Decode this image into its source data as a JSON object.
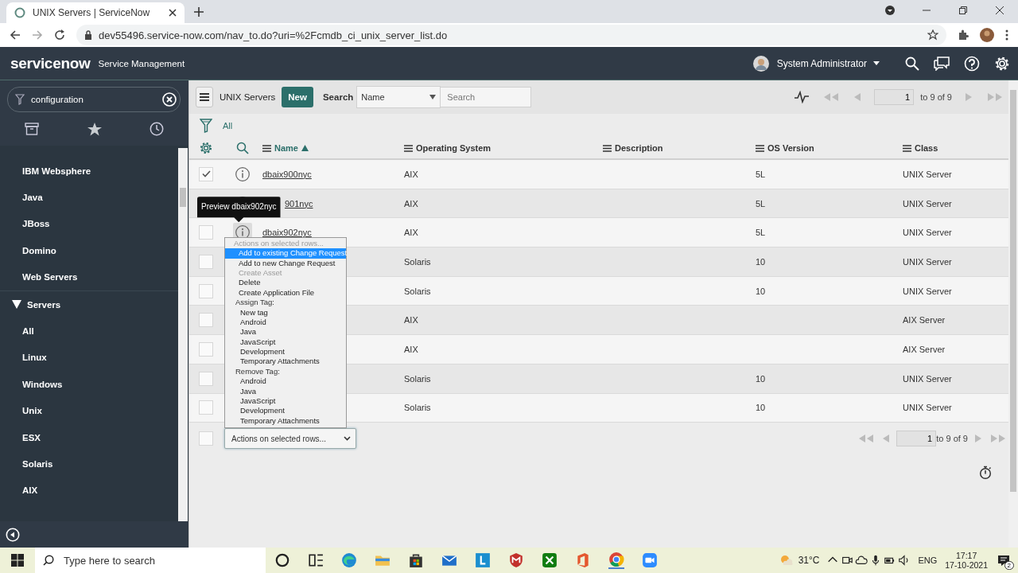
{
  "browser": {
    "tab": {
      "title": "UNIX Servers | ServiceNow",
      "selected": true
    },
    "address": "dev55496.service-now.com/nav_to.do?uri=%2Fcmdb_ci_unix_server_list.do"
  },
  "header": {
    "logo": "servicenow",
    "product": "Service Management",
    "user": "System Administrator"
  },
  "sidebar": {
    "filter": {
      "value": "configuration"
    },
    "items": [
      {
        "label": "IBM Websphere",
        "kind": "item"
      },
      {
        "label": "Java",
        "kind": "item"
      },
      {
        "label": "JBoss",
        "kind": "item"
      },
      {
        "label": "Domino",
        "kind": "item"
      },
      {
        "label": "Web Servers",
        "kind": "item"
      },
      {
        "label": "Servers",
        "kind": "section",
        "expanded": true,
        "children": [
          {
            "label": "All",
            "kind": "item"
          },
          {
            "label": "Linux",
            "kind": "item"
          },
          {
            "label": "Windows",
            "kind": "item"
          },
          {
            "label": "Unix",
            "kind": "item"
          },
          {
            "label": "ESX",
            "kind": "item"
          },
          {
            "label": "Solaris",
            "kind": "item"
          },
          {
            "label": "AIX",
            "kind": "item"
          }
        ]
      }
    ]
  },
  "list": {
    "title": "UNIX Servers",
    "new_button": "New",
    "search_label": "Search",
    "search_field": "Name",
    "search": {
      "placeholder": "Search"
    },
    "page": "1",
    "range": "to 9 of 9",
    "filter": "All",
    "columns": [
      {
        "label": "Name",
        "sorted": true
      },
      {
        "label": "Operating System",
        "sorted": false
      },
      {
        "label": "Description",
        "sorted": false
      },
      {
        "label": "OS Version",
        "sorted": false
      },
      {
        "label": "Class",
        "sorted": false
      }
    ],
    "rows": [
      {
        "checked": true,
        "name": "dbaix900nyc",
        "os": "AIX",
        "os_version": "5L",
        "class_name": "UNIX Server"
      },
      {
        "name": "901nyc",
        "name_partial": true,
        "os": "AIX",
        "os_version": "5L",
        "class_name": "UNIX Server"
      },
      {
        "checked": false,
        "name": "dbaix902nyc",
        "tooltip": "Preview dbaix902nyc",
        "os": "AIX",
        "os_version": "5L",
        "class_name": "UNIX Server"
      },
      {
        "checked": false,
        "os": "Solaris",
        "os_version": "10",
        "class_name": "UNIX Server"
      },
      {
        "checked": false,
        "os": "Solaris",
        "os_version": "10",
        "class_name": "UNIX Server"
      },
      {
        "checked": false,
        "os": "AIX",
        "class_name": "AIX Server"
      },
      {
        "checked": false,
        "os": "AIX",
        "class_name": "AIX Server"
      },
      {
        "checked": false,
        "os": "Solaris",
        "os_version": "10",
        "class_name": "UNIX Server"
      },
      {
        "checked": false,
        "os": "Solaris",
        "os_version": "10",
        "class_name": "UNIX Server"
      }
    ],
    "footer": {
      "checked": false,
      "actions": "Actions on selected rows...",
      "page": "1",
      "range": "to 9 of 9"
    },
    "menu": [
      {
        "label": "Actions on selected rows...",
        "kind": "prompt",
        "selected": false,
        "disabled": true
      },
      {
        "label": "Add to existing Change Request",
        "kind": "action",
        "selected": true,
        "disabled": false
      },
      {
        "label": "Add to new Change Request",
        "kind": "action",
        "selected": false,
        "disabled": false
      },
      {
        "label": "Create Asset",
        "kind": "action",
        "selected": false,
        "disabled": true
      },
      {
        "label": "Delete",
        "kind": "action",
        "selected": false,
        "disabled": false
      },
      {
        "label": "Create Application File",
        "kind": "action",
        "selected": false,
        "disabled": false
      },
      {
        "label": "Assign Tag:",
        "kind": "group",
        "selected": false,
        "disabled": false
      },
      {
        "label": "New tag",
        "kind": "tag",
        "selected": false,
        "disabled": false
      },
      {
        "label": "Android",
        "kind": "tag",
        "selected": false,
        "disabled": false
      },
      {
        "label": "Java",
        "kind": "tag",
        "selected": false,
        "disabled": false
      },
      {
        "label": "JavaScript",
        "kind": "tag",
        "selected": false,
        "disabled": false
      },
      {
        "label": "Development",
        "kind": "tag",
        "selected": false,
        "disabled": false
      },
      {
        "label": "Temporary Attachments",
        "kind": "tag",
        "selected": false,
        "disabled": false
      },
      {
        "label": "Remove Tag:",
        "kind": "group",
        "selected": false,
        "disabled": false
      },
      {
        "label": "Android",
        "kind": "tag",
        "selected": false,
        "disabled": false
      },
      {
        "label": "Java",
        "kind": "tag",
        "selected": false,
        "disabled": false
      },
      {
        "label": "JavaScript",
        "kind": "tag",
        "selected": false,
        "disabled": false
      },
      {
        "label": "Development",
        "kind": "tag",
        "selected": false,
        "disabled": false
      },
      {
        "label": "Temporary Attachments",
        "kind": "tag",
        "selected": false,
        "disabled": false
      }
    ]
  },
  "taskbar": {
    "search": {
      "placeholder": "Type here to search"
    },
    "temperature": "31°C",
    "language": "ENG",
    "time": "17:17",
    "date": "17-10-2021",
    "notifications": "2"
  }
}
